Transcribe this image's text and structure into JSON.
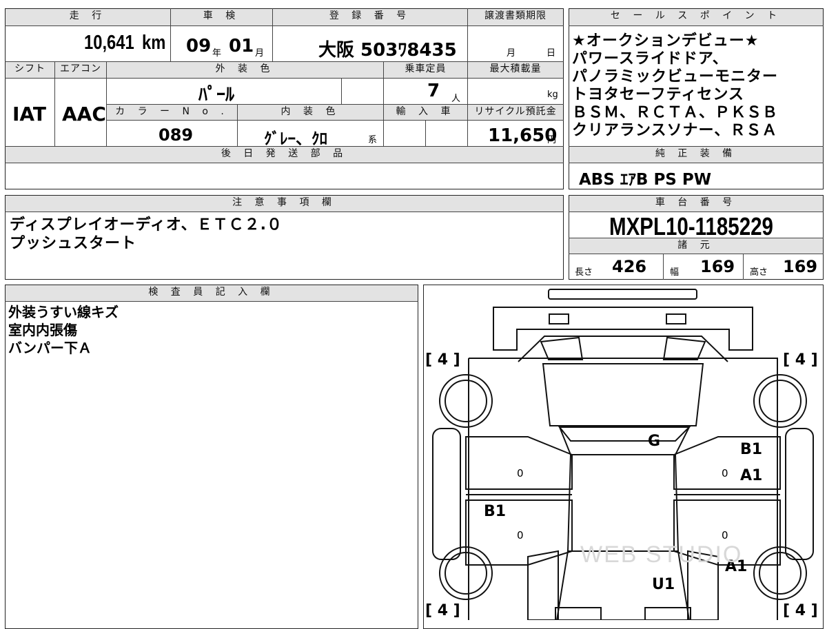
{
  "top": {
    "mileage_header": "走 行",
    "mileage_value": "10,641",
    "mileage_unit": "km",
    "shaken_header": "車 検",
    "shaken_year": "09",
    "shaken_year_unit": "年",
    "shaken_month": "01",
    "shaken_month_unit": "月",
    "reg_header": "登 録 番 号",
    "reg_value": "大阪 503ﾜ8435",
    "transfer_header": "譲渡書類期限",
    "transfer_month": "月",
    "transfer_day": "日"
  },
  "row2": {
    "shift_header": "シフト",
    "shift_value": "IAT",
    "ac_header": "エアコン",
    "ac_value": "AAC",
    "exterior_header": "外 装 色",
    "exterior_value": "ﾊﾟｰﾙ",
    "capacity_header": "乗車定員",
    "capacity_value": "7",
    "capacity_unit": "人",
    "maxload_header": "最大積載量",
    "maxload_unit": "kg",
    "color_no_header": "カ ラ ー N o .",
    "color_no_value": "089",
    "interior_header": "内 装 色",
    "interior_value": "ｸﾞﾚｰ、ｸﾛ",
    "interior_suffix": "系",
    "import_header": "輸 入 車",
    "recycle_header": "リサイクル預託金",
    "recycle_value": "11,650",
    "recycle_unit": "円"
  },
  "later_parts": {
    "header": "後 日 発 送 部 品"
  },
  "sales": {
    "header": "セ ー ル ス ポ イ ン ト",
    "lines": [
      "★オークションデビュー★",
      "パワースライドドア、",
      "パノラミックビューモニター",
      "トヨタセーフティセンス",
      "ＢＳＭ、ＲＣＴＡ、ＰＫＳＢ",
      "クリアランスソナー、ＲＳＡ"
    ]
  },
  "equipment": {
    "header": "純 正 装 備",
    "value": "ABS ｴｱB PS PW"
  },
  "notes": {
    "header": "注 意 事 項 欄",
    "lines": [
      "ディスプレイオーディオ、ＥＴＣ２.０",
      "プッシュスタート"
    ]
  },
  "chassis": {
    "header": "車 台 番 号",
    "value": "MXPL10-1185229"
  },
  "specs": {
    "header": "諸 元",
    "length_label": "長さ",
    "length_value": "426",
    "width_label": "幅",
    "width_value": "169",
    "height_label": "高さ",
    "height_value": "169"
  },
  "inspector": {
    "header": "検 査 員 記 入 欄",
    "lines": [
      "外装うすい線キズ",
      "室内内張傷",
      "バンパー下Ａ"
    ]
  },
  "diagram": {
    "tire_tl": "[ 4 ]",
    "tire_tr": "[ 4 ]",
    "tire_bl": "[ 4 ]",
    "tire_br": "[ 4 ]",
    "marks": {
      "windshield": "G",
      "right_front_door_upper": "B1",
      "right_front_door_lower": "A1",
      "left_rear_door": "B1",
      "right_rear_quarter": "A1",
      "rear_bumper": "U1"
    },
    "zero": "0",
    "watermark": "WEB STUDIO"
  }
}
